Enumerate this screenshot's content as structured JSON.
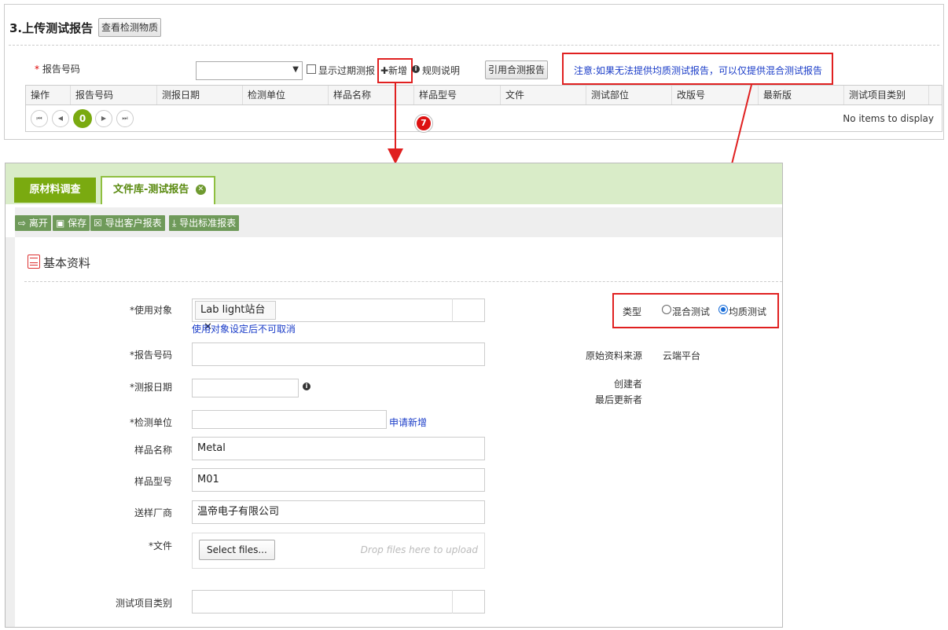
{
  "top": {
    "section_title": "3.上传测试报告",
    "view_substance_button": "查看检测物质",
    "report_no_label": "报告号码",
    "required_mark": "*",
    "show_expired_label": "显示过期测报",
    "add_button": "✚新增",
    "rules_label": "规则说明",
    "cite_mixed_button": "引用合测报告",
    "notice": "注意:如果无法提供均质测试报告，可以仅提供混合测试报告",
    "columns": [
      "操作",
      "报告号码",
      "测报日期",
      "检测单位",
      "样品名称",
      "样品型号",
      "文件",
      "测试部位",
      "改版号",
      "最新版",
      "测试项目类别"
    ],
    "pager": {
      "current_page": "0",
      "empty_text": "No items to display"
    },
    "step_badge": "7"
  },
  "bottom": {
    "tabs": [
      {
        "label": "原材料调查"
      },
      {
        "label": "文件库-测试报告"
      }
    ],
    "toolbar": {
      "leave": "离开",
      "save": "保存",
      "export_customer": "导出客户报表",
      "export_standard": "导出标准报表"
    },
    "section_title": "基本资料",
    "form": {
      "use_target_label": "*使用对象",
      "use_target_tag": "Lab light站台",
      "use_target_hint": "使用对象设定后不可取消",
      "report_no_label": "*报告号码",
      "report_no_value": "",
      "test_date_label": "*测报日期",
      "test_date_value": "",
      "lab_label": "*检测单位",
      "lab_value": "",
      "apply_new_link": "申请新增",
      "sample_name_label": "样品名称",
      "sample_name_value": "Metal",
      "sample_model_label": "样品型号",
      "sample_model_value": "M01",
      "vendor_label": "送样厂商",
      "vendor_value": "温帝电子有限公司",
      "file_label": "*文件",
      "select_files_button": "Select files...",
      "drop_hint": "Drop files here to upload",
      "test_category_label": "测试项目类别"
    },
    "side": {
      "type_label": "类型",
      "type_options": [
        {
          "label": "混合测试",
          "checked": false
        },
        {
          "label": "均质测试",
          "checked": true
        }
      ],
      "source_label": "原始资料来源",
      "source_value": "云端平台",
      "creator_label": "创建者",
      "updater_label": "最后更新者"
    }
  },
  "colors": {
    "accent_green": "#7aaa10",
    "tab_bar": "#d9ecc8",
    "toolbar_button": "#6f9a5a",
    "annotation_red": "#e02020",
    "link_blue": "#1a3cc8"
  }
}
